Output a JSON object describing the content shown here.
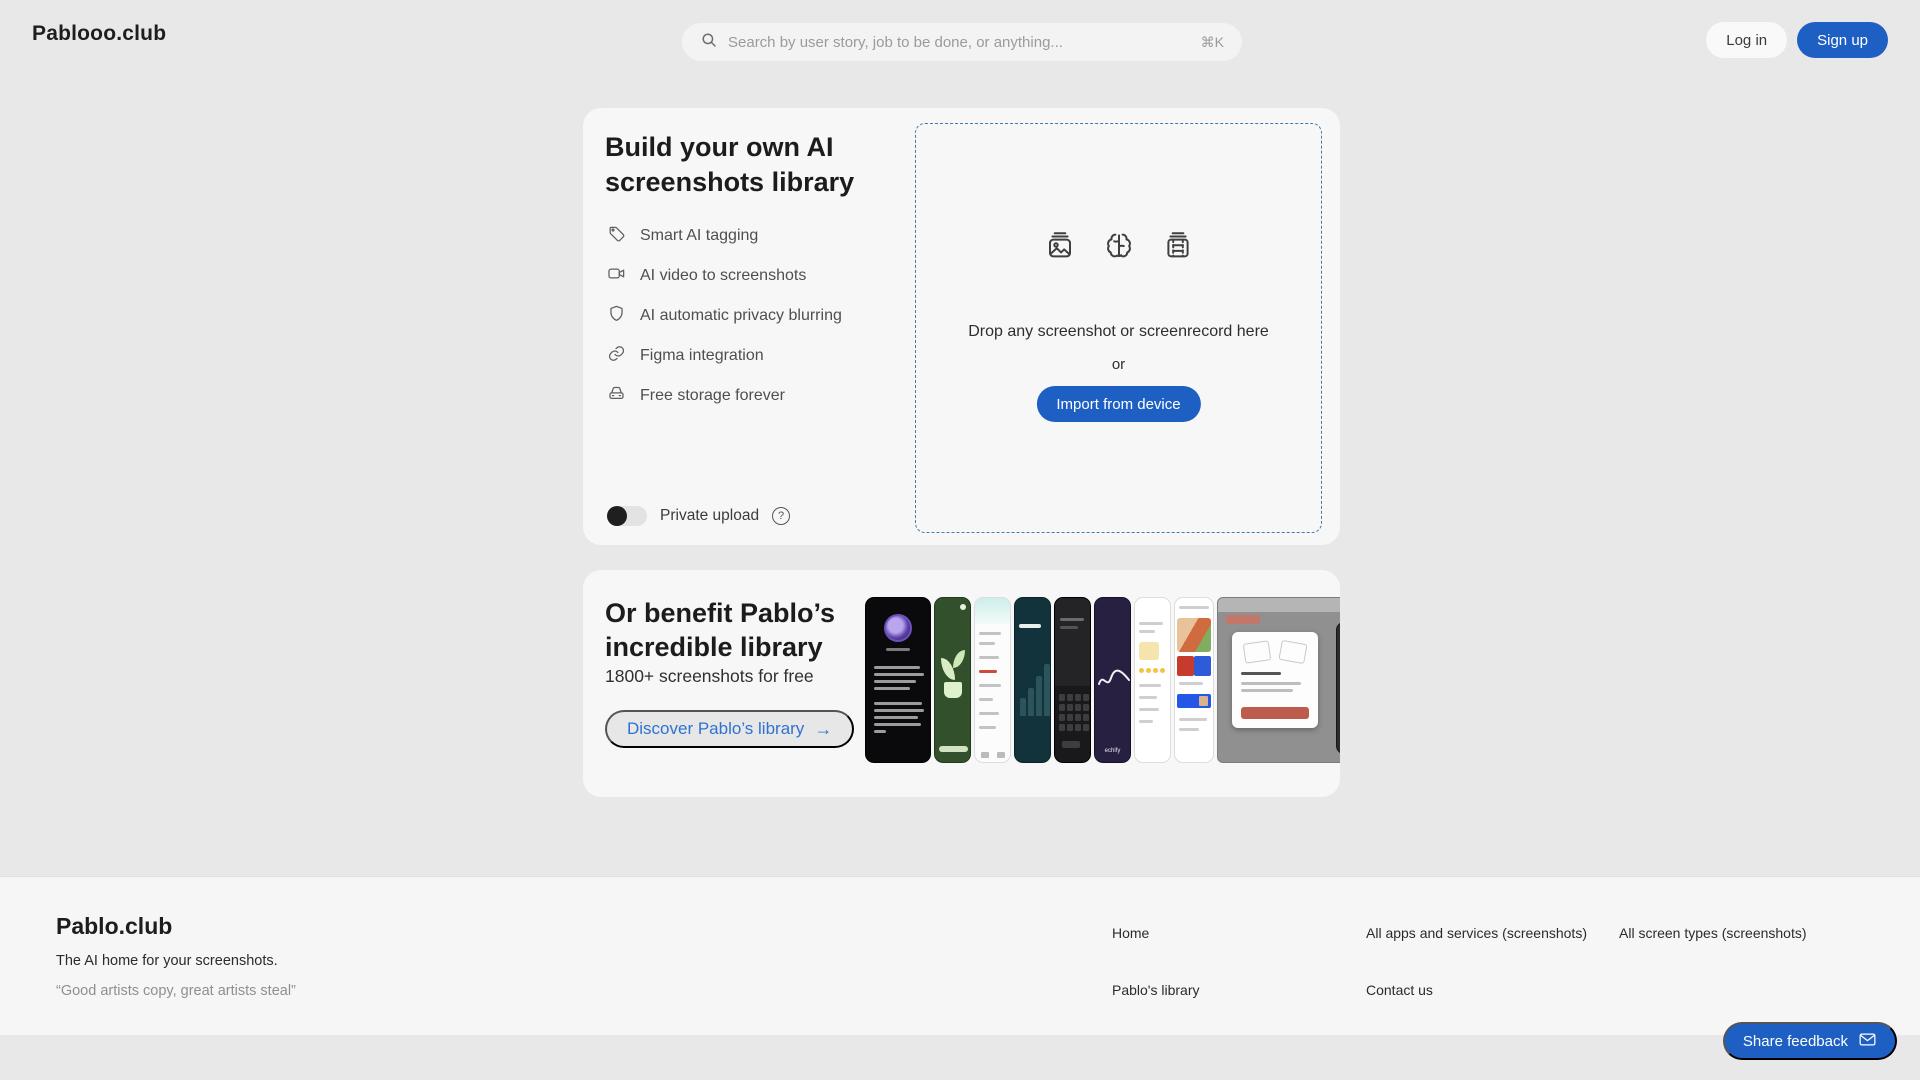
{
  "header": {
    "logo": "Pablooo.club",
    "search": {
      "placeholder": "Search by user story, job to be done, or anything...",
      "shortcut": "⌘K",
      "icon": "search-icon"
    },
    "login_label": "Log in",
    "signup_label": "Sign up"
  },
  "upload_card": {
    "title": "Build your own AI screenshots library",
    "features": [
      {
        "icon": "tag-icon",
        "label": "Smart AI tagging"
      },
      {
        "icon": "video-camera-icon",
        "label": "AI video to screenshots"
      },
      {
        "icon": "shield-icon",
        "label": "AI automatic privacy blurring"
      },
      {
        "icon": "link-icon",
        "label": "Figma integration"
      },
      {
        "icon": "storage-drive-icon",
        "label": "Free storage forever"
      }
    ],
    "private_upload": {
      "label": "Private upload",
      "state": "off",
      "help_icon": "question-circle-icon"
    },
    "dropzone": {
      "icons": [
        "photo-stack-icon",
        "brain-icon",
        "film-strip-icon"
      ],
      "drop_text": "Drop any screenshot or screenrecord here",
      "or_label": "or",
      "import_label": "Import from device"
    }
  },
  "library_card": {
    "title": "Or benefit Pablo’s incredible library",
    "subtitle": "1800+ screenshots for free",
    "cta_label": "Discover Pablo’s library",
    "cta_arrow": "→",
    "thumbnails": [
      "speechify-voice-intro-dark",
      "plant-care-green",
      "wellness-list-light",
      "your-effort-chart-teal",
      "keyboard-dark",
      "speechify-waveform-purple",
      "chat-emoji-light",
      "grocery-store-light",
      "welcome-modal-desktop"
    ]
  },
  "footer": {
    "brand": "Pablo.club",
    "tagline": "The AI home for your screenshots.",
    "quote": "“Good artists copy, great artists steal”",
    "links": {
      "col1": [
        "Home",
        "Pablo's library"
      ],
      "col2": [
        "All apps and services (screenshots)",
        "Contact us"
      ],
      "col3": [
        "All screen types (screenshots)"
      ]
    }
  },
  "feedback": {
    "label": "Share feedback",
    "icon": "envelope-icon"
  },
  "colors": {
    "page_bg": "#e8e8e8",
    "card_bg": "#f7f7f7",
    "footer_bg": "#f6f6f6",
    "accent_blue": "#1d5fc2",
    "link_blue": "#2f72d2",
    "dropzone_border": "#4879a8",
    "text_dark": "#1c1c1c",
    "text_muted": "#4f4f4f"
  }
}
